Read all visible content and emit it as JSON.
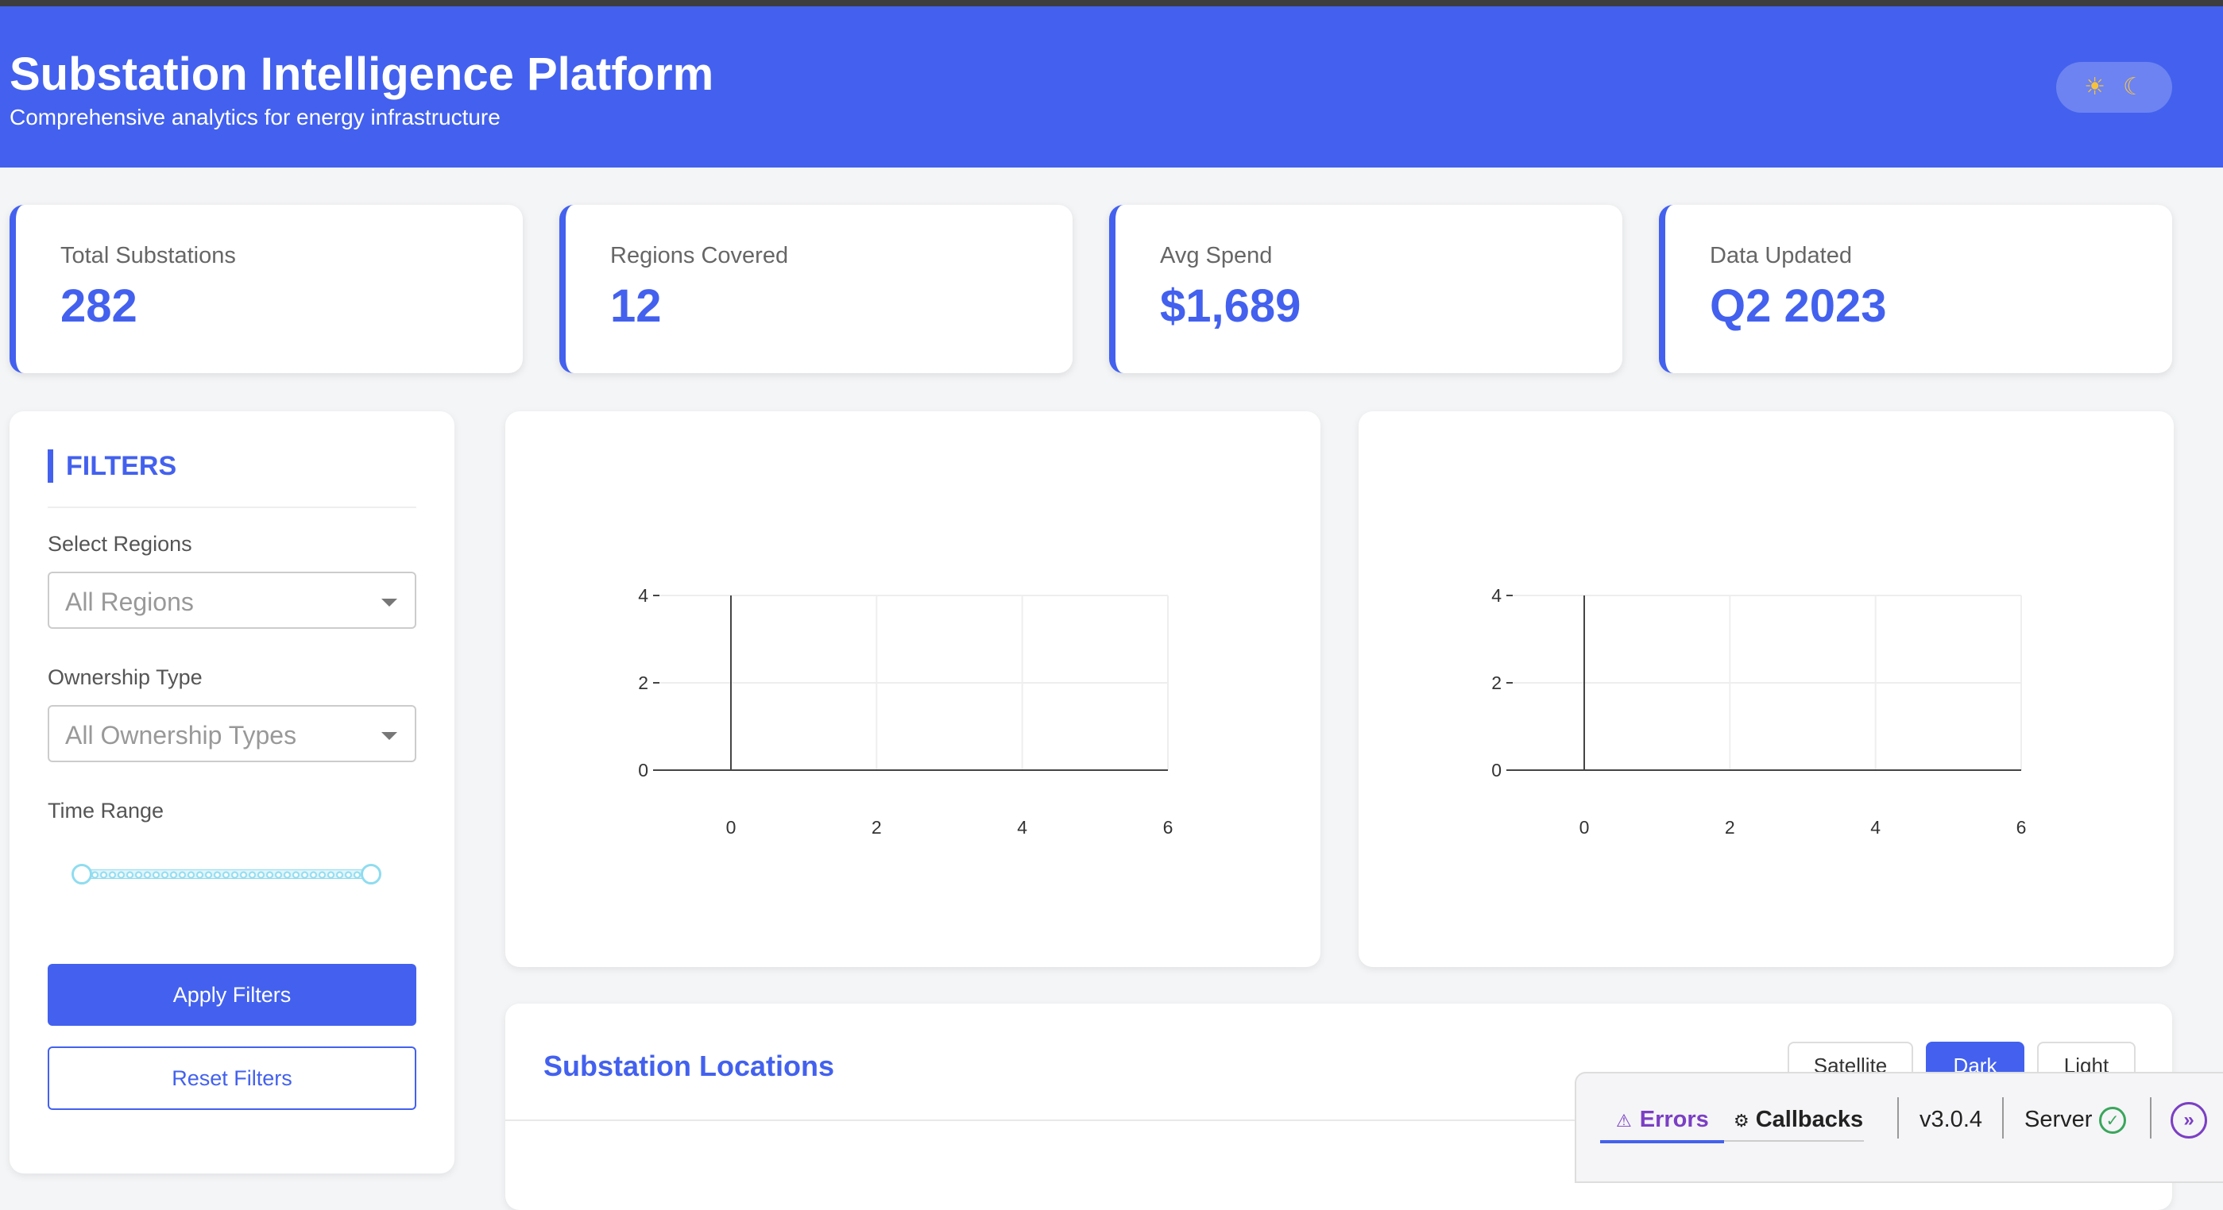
{
  "header": {
    "title": "Substation Intelligence Platform",
    "subtitle": "Comprehensive analytics for energy infrastructure",
    "theme_toggle": {
      "sun_icon": "☀",
      "moon_icon": "☾"
    }
  },
  "stats": [
    {
      "label": "Total Substations",
      "value": "282"
    },
    {
      "label": "Regions Covered",
      "value": "12"
    },
    {
      "label": "Avg Spend",
      "value": "$1,689"
    },
    {
      "label": "Data Updated",
      "value": "Q2 2023"
    }
  ],
  "filters": {
    "title": "FILTERS",
    "regions_label": "Select Regions",
    "regions_placeholder": "All Regions",
    "ownership_label": "Ownership Type",
    "ownership_placeholder": "All Ownership Types",
    "time_label": "Time Range",
    "time_range": {
      "low": 0,
      "high": 1
    },
    "apply_label": "Apply Filters",
    "reset_label": "Reset Filters"
  },
  "chart_data": [
    {
      "type": "line",
      "x": [],
      "y": [],
      "xlim": [
        0,
        6
      ],
      "ylim": [
        0,
        4
      ],
      "xticks": [
        "0",
        "2",
        "4",
        "6"
      ],
      "yticks": [
        "0",
        "2",
        "4"
      ],
      "grid": true
    },
    {
      "type": "line",
      "x": [],
      "y": [],
      "xlim": [
        0,
        6
      ],
      "ylim": [
        0,
        4
      ],
      "xticks": [
        "0",
        "2",
        "4",
        "6"
      ],
      "yticks": [
        "0",
        "2",
        "4"
      ],
      "grid": true
    }
  ],
  "map": {
    "title": "Substation Locations",
    "styles": [
      "Satellite",
      "Dark",
      "Light"
    ],
    "active_style": "Dark"
  },
  "devtools": {
    "errors_label": "Errors",
    "callbacks_label": "Callbacks",
    "version": "v3.0.4",
    "server_label": "Server",
    "server_ok": "✓",
    "expand_icon": "»"
  },
  "colors": {
    "accent": "#4361ee",
    "devtools_purple": "#7b3fc4",
    "server_ok": "#3aa65c"
  }
}
